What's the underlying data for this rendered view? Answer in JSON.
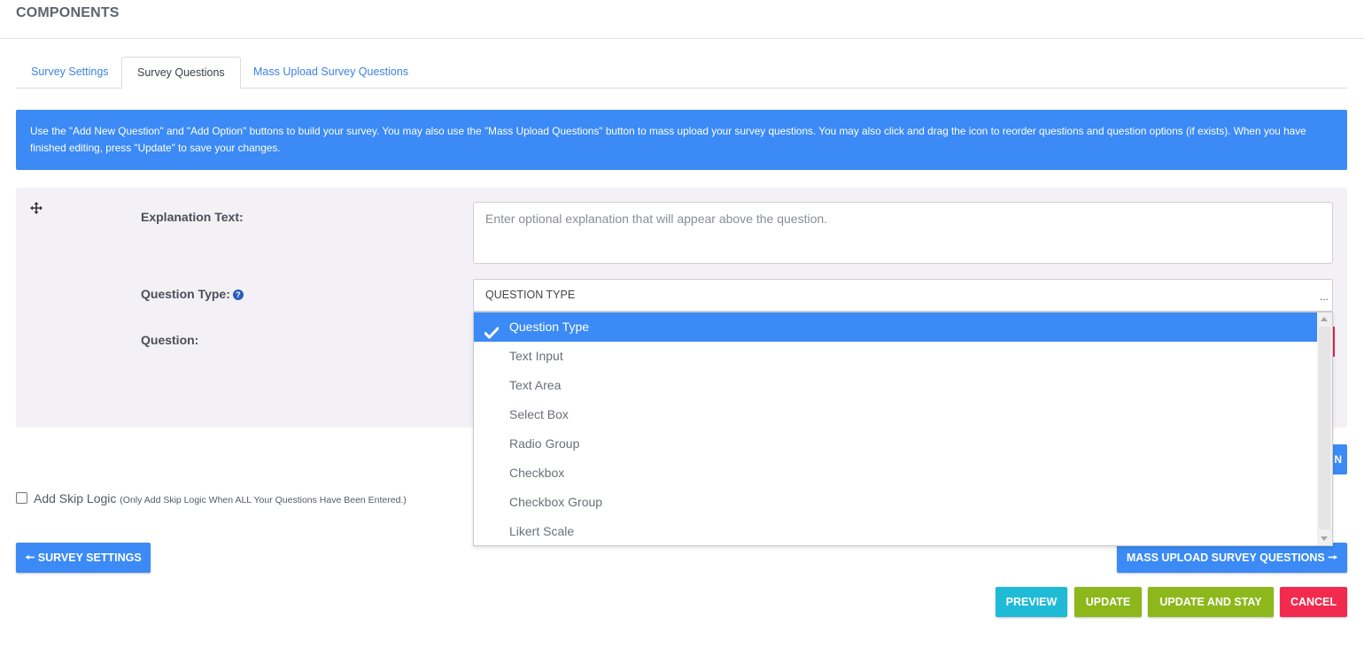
{
  "header": {
    "title": "COMPONENTS"
  },
  "tabs": [
    {
      "label": "Survey Settings",
      "active": false
    },
    {
      "label": "Survey Questions",
      "active": true
    },
    {
      "label": "Mass Upload Survey Questions",
      "active": false
    }
  ],
  "info_banner": {
    "text": "Use the \"Add New Question\" and \"Add Option\" buttons to build your survey. You may also use the \"Mass Upload Questions\" button to mass upload your survey questions. You may also click and drag the icon to reorder questions and question options (if exists). When you have finished editing, press \"Update\" to save your changes."
  },
  "question_form": {
    "drag_icon": "move-arrows-icon",
    "explanation_label": "Explanation Text:",
    "explanation_placeholder": "Enter optional explanation that will appear above the question.",
    "question_type_label": "Question Type:",
    "help_icon": "question-circle-icon",
    "question_type_value": "QUESTION TYPE",
    "select_ellipsis": "...",
    "question_label": "Question:"
  },
  "question_type_dropdown": {
    "options": [
      "Question Type",
      "Text Input",
      "Text Area",
      "Select Box",
      "Radio Group",
      "Checkbox",
      "Checkbox Group",
      "Likert Scale"
    ],
    "selected": "Question Type",
    "check_icon": "check-icon"
  },
  "partial_button_label": "N",
  "skip_logic": {
    "label": "Add Skip Logic",
    "note": "(Only Add Skip Logic When ALL Your Questions Have Been Entered.)",
    "checked": false
  },
  "nav_buttons": {
    "survey_settings": "SURVEY SETTINGS",
    "mass_upload": "MASS UPLOAD SURVEY QUESTIONS",
    "left_arrow_icon": "arrow-left-icon",
    "right_arrow_icon": "arrow-right-icon"
  },
  "action_buttons": {
    "preview": "PREVIEW",
    "update": "UPDATE",
    "update_and_stay": "UPDATE AND STAY",
    "cancel": "CANCEL"
  },
  "colors": {
    "primary_blue": "#3b8af5",
    "teal": "#1fbad6",
    "green": "#8cb81c",
    "red": "#f22b4e",
    "panel_bg": "#f3f1f6"
  }
}
